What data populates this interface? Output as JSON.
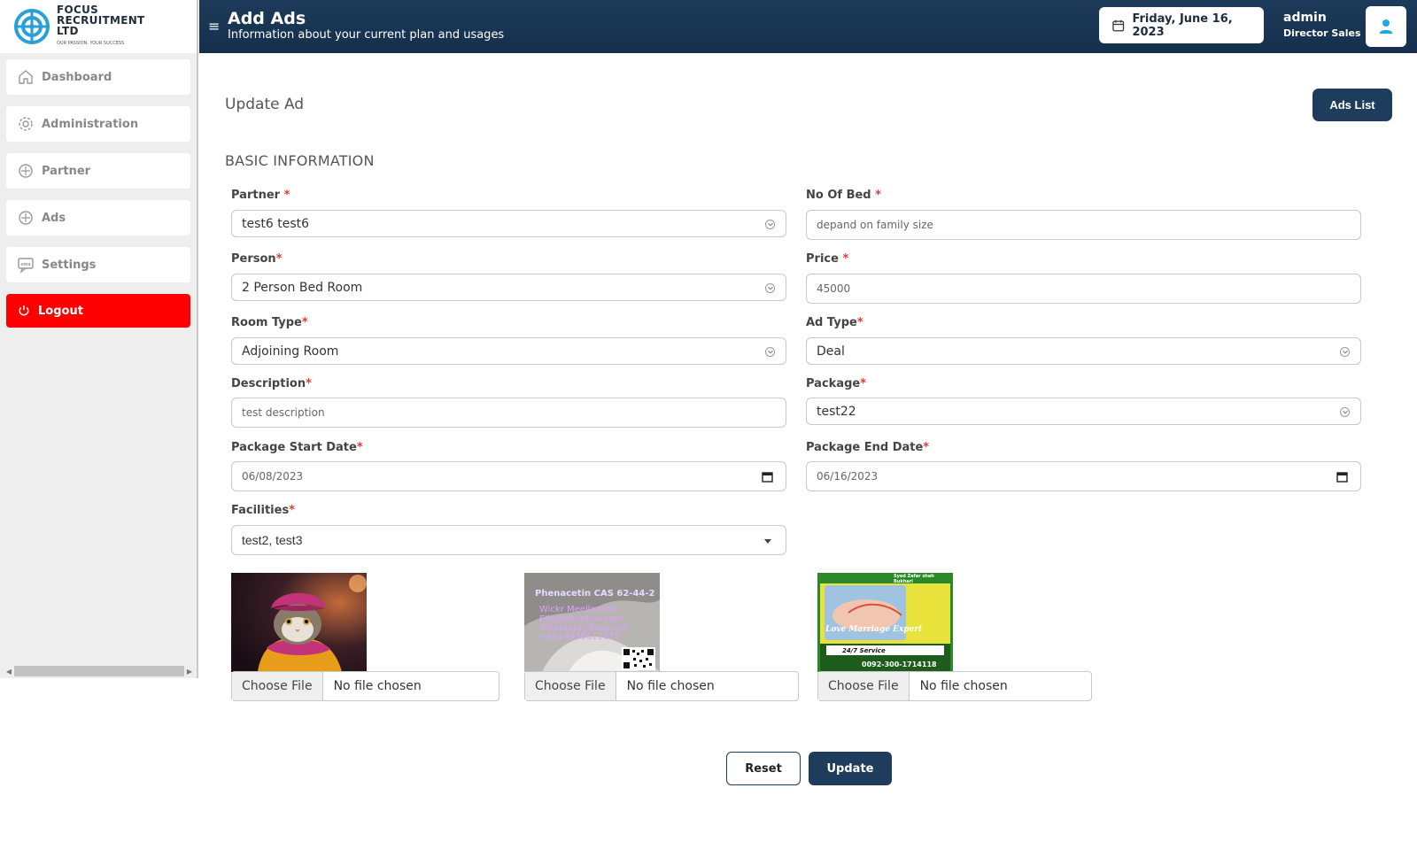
{
  "brand": {
    "name_line1": "FOCUS",
    "name_line2": "RECRUITMENT",
    "name_line3": "LTD",
    "tagline": "OUR PASSION, YOUR SUCCESS"
  },
  "sidebar": {
    "items": [
      {
        "label": "Dashboard",
        "icon": "home-icon"
      },
      {
        "label": "Administration",
        "icon": "gear-icon"
      },
      {
        "label": "Partner",
        "icon": "partner-icon"
      },
      {
        "label": "Ads",
        "icon": "ads-icon"
      },
      {
        "label": "Settings",
        "icon": "sms-icon"
      }
    ],
    "logout_label": "Logout"
  },
  "header": {
    "title": "Add Ads",
    "subtitle": "Information about your current plan and usages",
    "date": "Friday, June 16, 2023",
    "user_name": "admin",
    "user_role": "Director Sales"
  },
  "page": {
    "title": "Update Ad",
    "ads_list_label": "Ads List",
    "section_title": "BASIC INFORMATION"
  },
  "form": {
    "partner": {
      "label": "Partner",
      "value": "test6 test6"
    },
    "no_of_bed": {
      "label": "No Of Bed",
      "placeholder": "depand on family size"
    },
    "person": {
      "label": "Person",
      "value": "2 Person Bed Room"
    },
    "price": {
      "label": "Price",
      "value": "45000"
    },
    "room_type": {
      "label": "Room Type",
      "value": "Adjoining Room"
    },
    "ad_type": {
      "label": "Ad Type",
      "value": "Deal"
    },
    "description": {
      "label": "Description",
      "value": "test description"
    },
    "package": {
      "label": "Package",
      "value": "test22"
    },
    "package_start_date": {
      "label": "Package Start Date",
      "value": "06/08/2023"
    },
    "package_end_date": {
      "label": "Package End Date",
      "value": "06/16/2023"
    },
    "facilities": {
      "label": "Facilities",
      "value": "test2, test3"
    },
    "required_mark": "*"
  },
  "images": [
    {
      "name": "cat-image"
    },
    {
      "name": "powder-image",
      "overlay_text": [
        "Phenacetin CAS 62-44-2",
        "Wickr Meellazebo",
        "Ella@hbzeboo.com",
        "WhatsApp/Telegram",
        "+8619930611675"
      ]
    },
    {
      "name": "marriage-image",
      "overlay_text": [
        "Love Marriage Expert",
        "24/7 Service",
        "0092-300-1714118",
        "Syed Zafar shah Bukhari"
      ]
    }
  ],
  "file_input": {
    "button_label": "Choose File",
    "status": "No file chosen"
  },
  "actions": {
    "reset_label": "Reset",
    "update_label": "Update"
  },
  "colors": {
    "primary": "#1e3d5c",
    "logout": "#ff0000",
    "header": "#14304d"
  }
}
